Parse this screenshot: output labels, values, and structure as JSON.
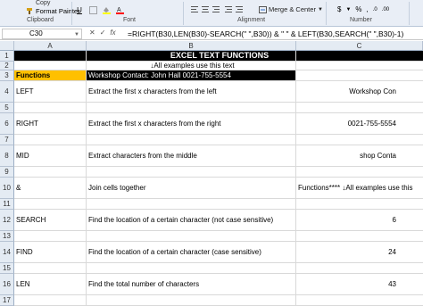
{
  "ribbon": {
    "copy_label": "Copy",
    "format_painter_label": "Format Painter",
    "groups": [
      "Clipboard",
      "Font",
      "Alignment",
      "Number"
    ],
    "merge_label": "Merge & Center",
    "currency_symbol": "$",
    "percent_symbol": "%",
    "comma_symbol": ",",
    "font_underline": "U",
    "accent_fill": "#ffff00",
    "accent_font": "#ff0000"
  },
  "formula_bar": {
    "cell_ref": "C30",
    "fx": "fx",
    "formula": "=RIGHT(B30,LEN(B30)-SEARCH(\" \",B30)) & \" \" & LEFT(B30,SEARCH(\" \",B30)-1)"
  },
  "columns": [
    "A",
    "B",
    "C"
  ],
  "rows": [
    {
      "num": "1",
      "a": "",
      "b": "EXCEL TEXT FUNCTIONS",
      "c": ""
    },
    {
      "num": "2",
      "a": "",
      "b": "↓All examples use this text",
      "c": ""
    },
    {
      "num": "3",
      "a": "Functions",
      "b": "Workshop Contact: John Hall 0021-755-5554",
      "c": ""
    },
    {
      "num": "4",
      "a": "LEFT",
      "b": "Extract the first x characters from the left",
      "c": "Workshop Con"
    },
    {
      "num": "5",
      "a": "",
      "b": "",
      "c": ""
    },
    {
      "num": "6",
      "a": "RIGHT",
      "b": "Extract the first x characters from the right",
      "c": "0021-755-5554"
    },
    {
      "num": "7",
      "a": "",
      "b": "",
      "c": ""
    },
    {
      "num": "8",
      "a": "MID",
      "b": "Extract characters from the middle",
      "c": "shop Conta"
    },
    {
      "num": "9",
      "a": "",
      "b": "",
      "c": ""
    },
    {
      "num": "10",
      "a": "&",
      "b": "Join cells together",
      "c": "Functions**** ↓All examples use this"
    },
    {
      "num": "11",
      "a": "",
      "b": "",
      "c": ""
    },
    {
      "num": "12",
      "a": "SEARCH",
      "b": "Find the location of a certain character (not case sensitive)",
      "c": "6"
    },
    {
      "num": "13",
      "a": "",
      "b": "",
      "c": ""
    },
    {
      "num": "14",
      "a": "FIND",
      "b": "Find the location of a certain character (case sensitive)",
      "c": "24"
    },
    {
      "num": "15",
      "a": "",
      "b": "",
      "c": ""
    },
    {
      "num": "16",
      "a": "LEN",
      "b": "Find the total number of characters",
      "c": "43"
    },
    {
      "num": "17",
      "a": "",
      "b": "",
      "c": ""
    }
  ],
  "colors": {
    "title_bg": "#000000",
    "title_fg": "#ffffff",
    "functions_bg": "#ffc000",
    "black_band": "#000000"
  }
}
